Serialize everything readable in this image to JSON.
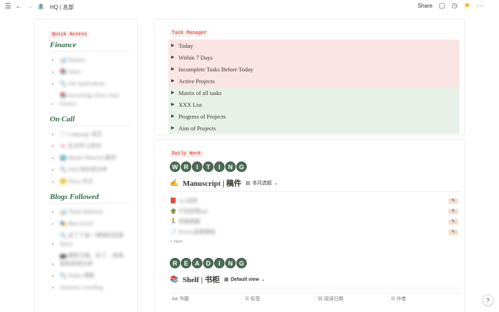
{
  "topbar": {
    "title": "HQ | 总部",
    "share_label": "Share"
  },
  "left": {
    "quick_access": "Quick Access",
    "sections": [
      {
        "title": "Finance",
        "items": [
          {
            "icon": "📊",
            "text": "Balance"
          },
          {
            "icon": "📚",
            "text": "Notes"
          },
          {
            "icon": "🔍",
            "text": "Job Applications"
          },
          {
            "icon": "📚",
            "text": "Knowledge Base: Data Finance"
          }
        ]
      },
      {
        "title": "On Call",
        "items": [
          {
            "icon": "📄",
            "text": "Language 语言"
          },
          {
            "icon": "🍬",
            "text": "生活学习资讯"
          },
          {
            "icon": "🌍",
            "text": "Master Material 素材"
          },
          {
            "icon": "🔍",
            "text": "Wall 资料库分享"
          },
          {
            "icon": "🙂",
            "text": "Diary 日记"
          }
        ]
      },
      {
        "title": "Blogs Followed",
        "items": [
          {
            "icon": "📊",
            "text": "Think Different"
          },
          {
            "icon": "🎭",
            "text": "Blue Ketch"
          },
          {
            "icon": "🔍",
            "text": "女丁丁家一博博的院落 Space"
          },
          {
            "icon": "📷",
            "text": "摄影日报、好了、美景、更新新频分享"
          },
          {
            "icon": "🔍",
            "text": "Nudes 博客"
          },
          {
            "icon": "",
            "text": "iutomatic.com/blog"
          }
        ]
      }
    ]
  },
  "tasks": {
    "tag": "Task Manager",
    "items": [
      {
        "label": "Today",
        "color": "red"
      },
      {
        "label": "Within 7 Days",
        "color": "red"
      },
      {
        "label": "Incomplete Tasks Before Today",
        "color": "red"
      },
      {
        "label": "Active  Projects",
        "color": "red"
      },
      {
        "label": "Matrix of all tasks",
        "color": "green"
      },
      {
        "label": "XXX List",
        "color": "green"
      },
      {
        "label": "Progress of  Projects",
        "color": "green"
      },
      {
        "label": "Aim of  Projects",
        "color": "green"
      }
    ]
  },
  "daily": {
    "tag": "Daily Work",
    "writing_letters": [
      "W",
      "R",
      "I",
      "T",
      "I",
      "N",
      "G"
    ],
    "manuscript": {
      "emoji": "✍️",
      "title": "Manuscript | 稿件",
      "view_label": "本月选题",
      "rows": [
        {
          "icon": "📕",
          "text": "xxx选题"
        },
        {
          "icon": "🪴",
          "text": "计划选题app"
        },
        {
          "icon": "🏃",
          "text": "草稿摘要"
        },
        {
          "icon": "📄",
          "text": "Notion选题模板"
        }
      ],
      "new_label": "+ New"
    },
    "reading_letters": [
      "R",
      "E",
      "A",
      "D",
      "I",
      "N",
      "G"
    ],
    "shelf": {
      "emoji": "📚",
      "title": "Shelf | 书柜",
      "view_label": "Default view",
      "columns": [
        "Aa 书籍",
        "☰ 标签",
        "▦ 阅读日期",
        "☰ 作者"
      ]
    }
  },
  "help_label": "?"
}
